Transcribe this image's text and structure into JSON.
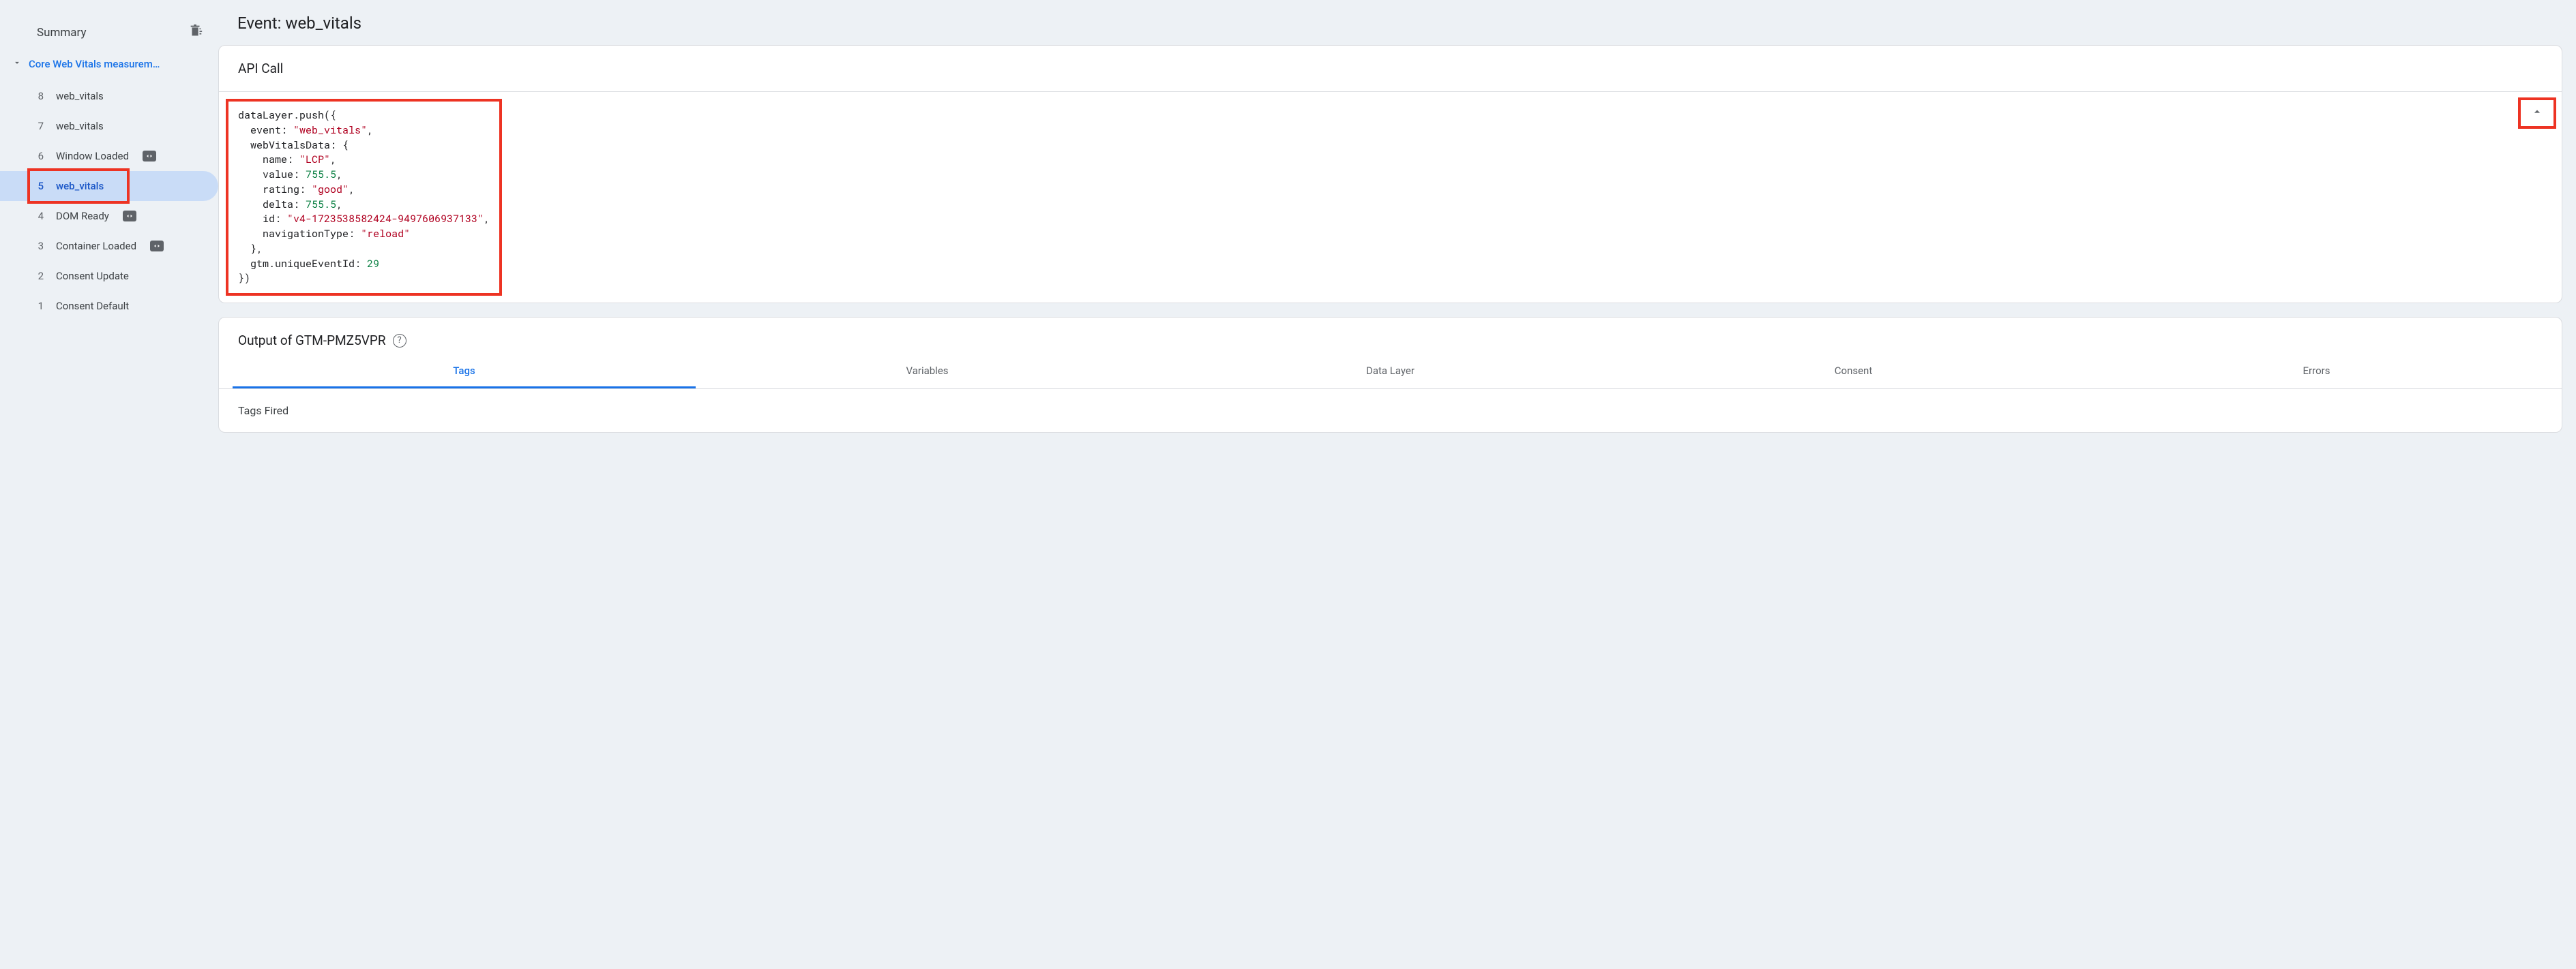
{
  "sidebar": {
    "summary_label": "Summary",
    "tree_header": "Core Web Vitals measurem…",
    "events": [
      {
        "num": "8",
        "label": "web_vitals",
        "badge": false
      },
      {
        "num": "7",
        "label": "web_vitals",
        "badge": false
      },
      {
        "num": "6",
        "label": "Window Loaded",
        "badge": true
      },
      {
        "num": "5",
        "label": "web_vitals",
        "badge": false,
        "selected": true
      },
      {
        "num": "4",
        "label": "DOM Ready",
        "badge": true
      },
      {
        "num": "3",
        "label": "Container Loaded",
        "badge": true
      },
      {
        "num": "2",
        "label": "Consent Update",
        "badge": false
      },
      {
        "num": "1",
        "label": "Consent Default",
        "badge": false
      }
    ]
  },
  "main": {
    "title": "Event: web_vitals",
    "api_call_header": "API Call",
    "api_call_code": {
      "fn": "dataLayer.push",
      "event_key": "event",
      "event_val": "\"web_vitals\"",
      "wvd_key": "webVitalsData",
      "name_key": "name",
      "name_val": "\"LCP\"",
      "value_key": "value",
      "value_val": "755.5",
      "rating_key": "rating",
      "rating_val": "\"good\"",
      "delta_key": "delta",
      "delta_val": "755.5",
      "id_key": "id",
      "id_val": "\"v4-1723538582424-9497606937133\"",
      "navtype_key": "navigationType",
      "navtype_val": "\"reload\"",
      "gtm_key": "gtm.uniqueEventId",
      "gtm_val": "29"
    },
    "output_header": "Output of GTM-PMZ5VPR",
    "tabs": [
      "Tags",
      "Variables",
      "Data Layer",
      "Consent",
      "Errors"
    ],
    "tags_fired_label": "Tags Fired"
  }
}
